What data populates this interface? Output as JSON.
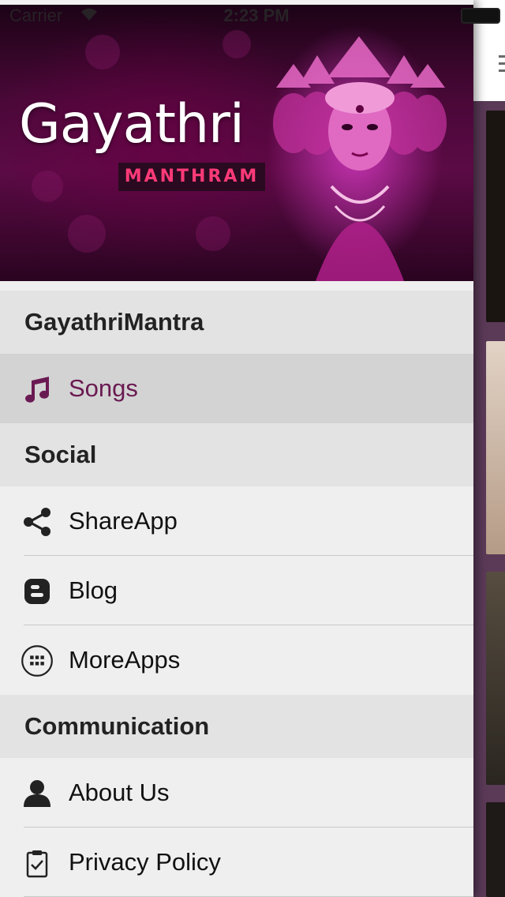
{
  "status_bar": {
    "carrier": "Carrier",
    "time": "2:23 PM",
    "wifi_icon": "wifi-icon",
    "battery_icon": "battery-icon"
  },
  "banner": {
    "title": "Gayathri",
    "subtitle": "MANTHRAM"
  },
  "menu": {
    "sections": [
      {
        "header": "GayathriMantra",
        "items": [
          {
            "label": "Songs",
            "icon": "music-note-icon",
            "selected": true
          }
        ]
      },
      {
        "header": "Social",
        "items": [
          {
            "label": "ShareApp",
            "icon": "share-icon"
          },
          {
            "label": "Blog",
            "icon": "blogger-icon"
          },
          {
            "label": "MoreApps",
            "icon": "app-grid-icon"
          }
        ]
      },
      {
        "header": "Communication",
        "items": [
          {
            "label": "About Us",
            "icon": "person-icon"
          },
          {
            "label": "Privacy Policy",
            "icon": "clipboard-check-icon"
          }
        ]
      }
    ]
  },
  "colors": {
    "accent": "#6a1a52",
    "selected_background": "#d3d3d3",
    "section_background": "#e3e3e3",
    "item_background": "#efefef",
    "main_view_background": "#5b3a58"
  }
}
